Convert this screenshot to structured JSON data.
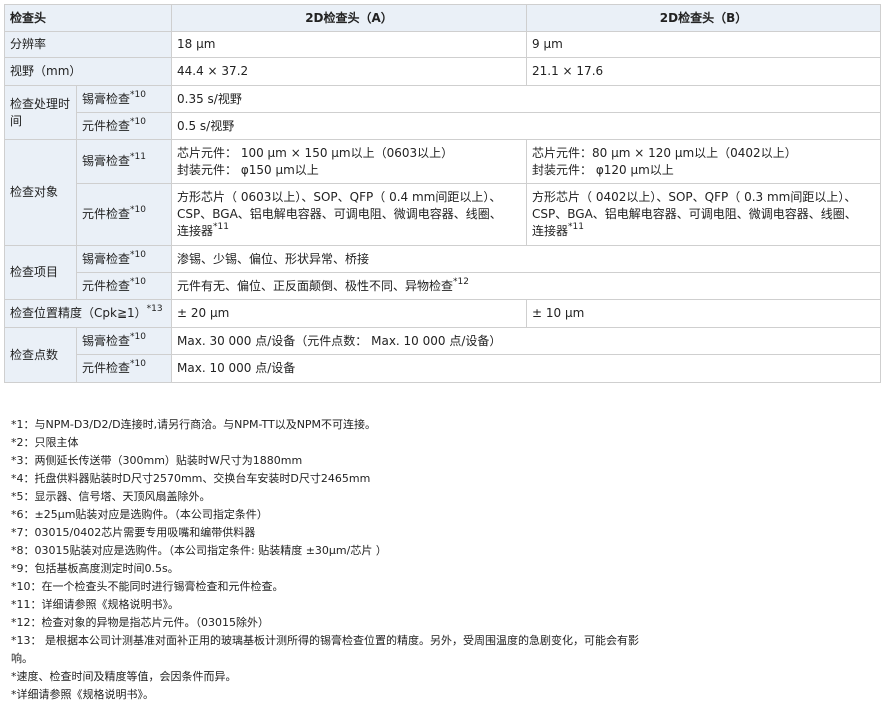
{
  "table": {
    "header": {
      "col0": "检查头",
      "colA": "2D检查头（A）",
      "colB": "2D检查头（B）"
    },
    "resolution": {
      "label": "分辨率",
      "a": "18 μm",
      "b": "9 μm"
    },
    "fov": {
      "label": "视野（mm）",
      "a": "44.4 × 37.2",
      "b": "21.1 × 17.6"
    },
    "processing": {
      "label": "检查处理时间",
      "solder": {
        "label": "锡膏检查",
        "sup": "*10",
        "value": "0.35 s/视野"
      },
      "component": {
        "label": "元件检查",
        "sup": "*10",
        "value": "0.5 s/视野"
      }
    },
    "objects": {
      "label": "检查对象",
      "solder": {
        "label": "锡膏检查",
        "sup": "*11",
        "a1": "芯片元件： 100 μm × 150 μm以上（0603以上）",
        "a2": "封装元件： φ150 μm以上",
        "b1": "芯片元件：80 μm × 120 μm以上（0402以上）",
        "b2": "封装元件： φ120 μm以上"
      },
      "component": {
        "label": "元件检查",
        "sup": "*10",
        "a1": "方形芯片（ 0603以上）、SOP、QFP（ 0.4 mm间距以上）、",
        "a2": "CSP、BGA、铝电解电容器、可调电阻、微调电容器、线圈、",
        "a3": "连接器",
        "a_sup": "*11",
        "b1": "方形芯片（ 0402以上）、SOP、QFP（ 0.3 mm间距以上）、",
        "b2": "CSP、BGA、铝电解电容器、可调电阻、微调电容器、线圈、",
        "b3": "连接器",
        "b_sup": "*11"
      }
    },
    "items": {
      "label": "检查项目",
      "solder": {
        "label": "锡膏检查",
        "sup": "*10",
        "value": "渗锡、少锡、偏位、形状异常、桥接"
      },
      "component": {
        "label": "元件检查",
        "sup": "*10",
        "value": "元件有无、偏位、正反面颠倒、极性不同、异物检查",
        "value_sup": "*12"
      }
    },
    "accuracy": {
      "label": "检查位置精度（Cpk≧1）",
      "sup": "*13",
      "a": "± 20 μm",
      "b": "± 10 μm"
    },
    "points": {
      "label": "检查点数",
      "solder": {
        "label": "锡膏检查",
        "sup": "*10",
        "value": "Max. 30 000 点/设备（元件点数： Max. 10 000 点/设备）"
      },
      "component": {
        "label": "元件检查",
        "sup": "*10",
        "value": "Max. 10 000 点/设备"
      }
    }
  },
  "notes": [
    "*1：与NPM-D3/D2/D连接时,请另行商洽。与NPM-TT以及NPM不可连接。",
    "*2：只限主体",
    "*3：两侧延长传送带（300mm）贴装时W尺寸为1880mm",
    "*4：托盘供料器贴装时D尺寸2570mm、交换台车安装时D尺寸2465mm",
    "*5：显示器、信号塔、天顶风扇盖除外。",
    "*6：±25μm贴装对应是选购件。（本公司指定条件）",
    "*7：03015/0402芯片需要专用吸嘴和编带供料器",
    "*8：03015贴装对应是选购件。（本公司指定条件: 贴装精度 ±30μm/芯片 ）",
    "*9：包括基板高度测定时间0.5s。",
    "*10：在一个检查头不能同时进行锡膏检查和元件检查。",
    "*11：详细请参照《规格说明书》。",
    "*12：检查对象的异物是指芯片元件。（03015除外）",
    "*13： 是根据本公司计测基准对面补正用的玻璃基板计测所得的锡膏检查位置的精度。另外，受周围温度的急剧变化，可能会有影",
    "响。",
    "*速度、检查时间及精度等值，会因条件而异。",
    "*详细请参照《规格说明书》。"
  ]
}
